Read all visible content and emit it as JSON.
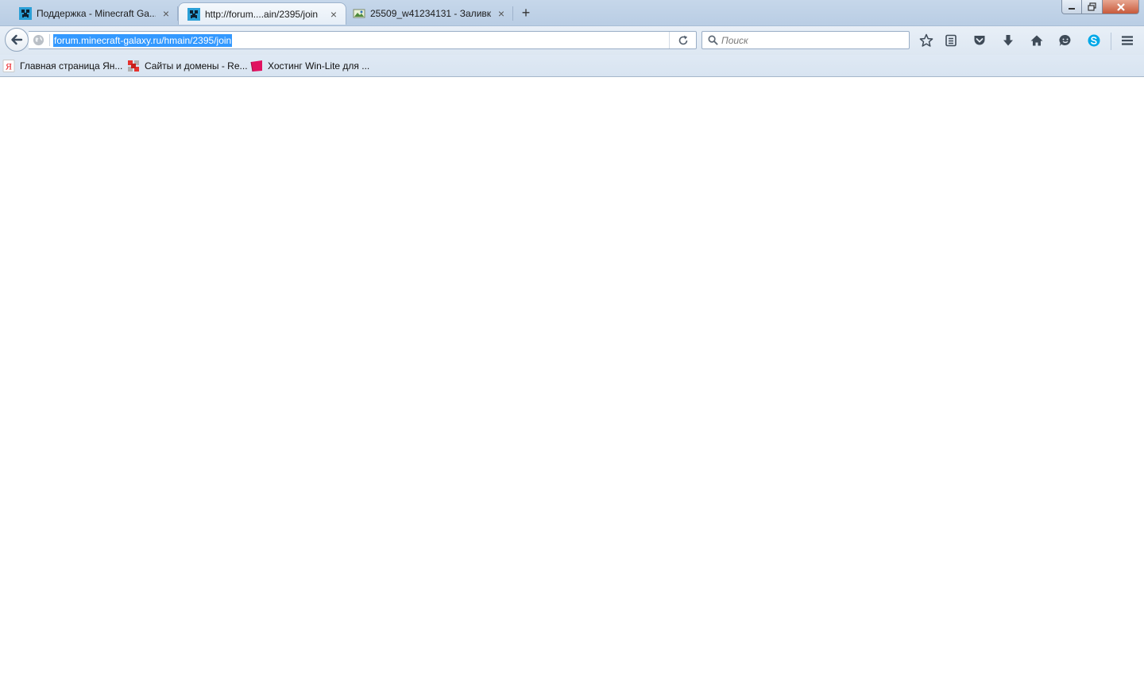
{
  "tabs": [
    {
      "title": "Поддержка - Minecraft Ga...",
      "icon": "creeper-favicon-icon"
    },
    {
      "title": "http://forum....ain/2395/join",
      "icon": "creeper-favicon-icon"
    },
    {
      "title": "25509_w41234131 - Заливк...",
      "icon": "image-favicon-icon"
    }
  ],
  "url": "forum.minecraft-galaxy.ru/hmain/2395/join",
  "search": {
    "placeholder": "Поиск",
    "value": ""
  },
  "bookmarks": [
    {
      "label": "Главная страница Ян...",
      "icon": "yandex-icon"
    },
    {
      "label": "Сайты и домены - Re...",
      "icon": "reg-ru-icon"
    },
    {
      "label": "Хостинг Win-Lite для ...",
      "icon": "winlite-icon"
    }
  ],
  "colors": {
    "selection": "#3399ff",
    "chrome": "#c6d7ea"
  }
}
